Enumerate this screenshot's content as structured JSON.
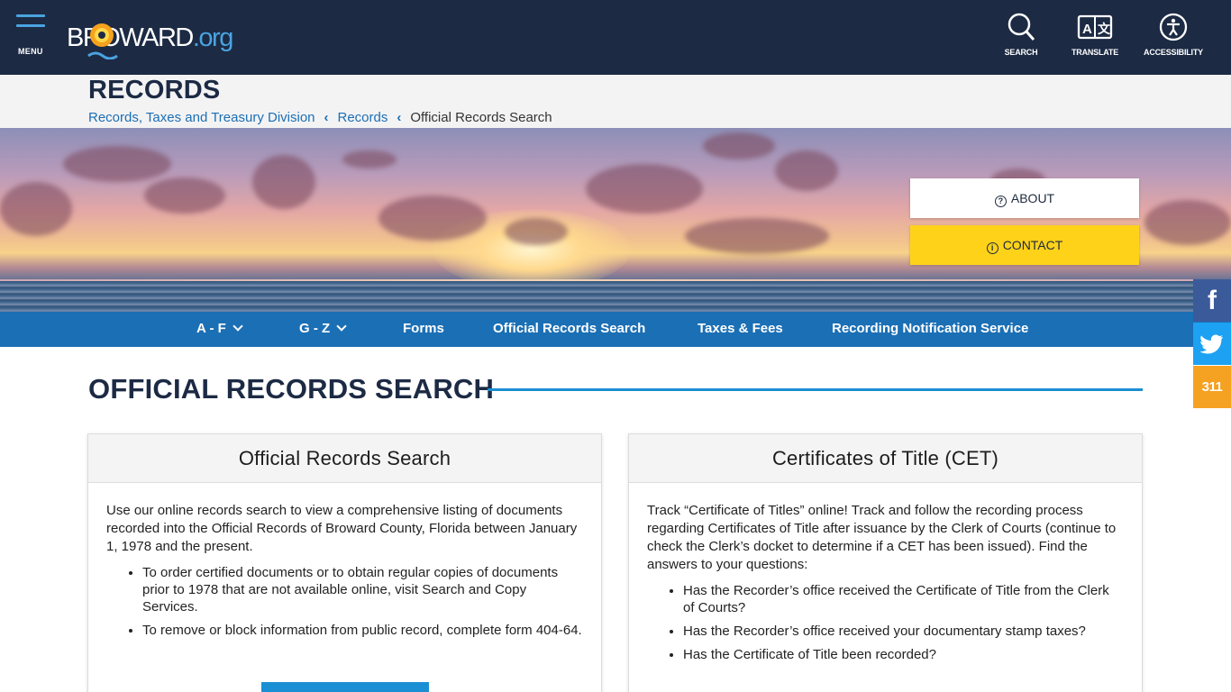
{
  "header": {
    "menu_label": "MENU",
    "logo_text_main": "BROWARD",
    "logo_text_suffix": ".org",
    "tools": [
      {
        "label": "SEARCH",
        "icon": "search-icon"
      },
      {
        "label": "TRANSLATE",
        "icon": "translate-icon"
      },
      {
        "label": "ACCESSIBILITY",
        "icon": "accessibility-icon"
      }
    ]
  },
  "page": {
    "title": "RECORDS",
    "breadcrumbs": [
      {
        "label": "Records, Taxes and Treasury Division"
      },
      {
        "label": "Records"
      },
      {
        "label": "Official Records Search"
      }
    ]
  },
  "hero": {
    "about_label": "ABOUT",
    "contact_label": "CONTACT"
  },
  "subnav": {
    "items": [
      {
        "label": "A - F"
      },
      {
        "label": "G - Z"
      },
      {
        "label": "Forms"
      },
      {
        "label": "Official Records Search"
      },
      {
        "label": "Taxes & Fees"
      },
      {
        "label": "Recording Notification Service"
      }
    ]
  },
  "social": {
    "facebook": "f",
    "twitter_icon": "twitter-icon",
    "s311": "311"
  },
  "main": {
    "section_title": "OFFICIAL RECORDS SEARCH",
    "cards": [
      {
        "title": "Official Records Search",
        "intro": "Use our online records search to view a comprehensive listing of documents recorded into the Official Records of Broward County, Florida between January 1, 1978 and the present.",
        "bullets": [
          "To order certified documents or to obtain regular copies of documents prior to 1978 that are not available online, visit Search and Copy Services.",
          "To remove or block information from public record, complete form 404-64."
        ]
      },
      {
        "title": "Certificates of Title (CET)",
        "intro": "Track “Certificate of Titles” online! Track and follow the recording process regarding Certificates of Title after issuance by the Clerk of Courts (continue to check the Clerk’s docket to determine if a CET has been issued). Find the answers to your questions:",
        "bullets": [
          "Has the Recorder’s office received the Certificate of Title from the Clerk of Courts?",
          "Has the Recorder’s office received your documentary stamp taxes?",
          "Has the Certificate of Title been recorded?"
        ]
      }
    ]
  },
  "colors": {
    "topbar": "#1c2a44",
    "brand_blue": "#1b6fb5",
    "accent_yellow": "#ffd21a",
    "orange_311": "#f5a121"
  }
}
